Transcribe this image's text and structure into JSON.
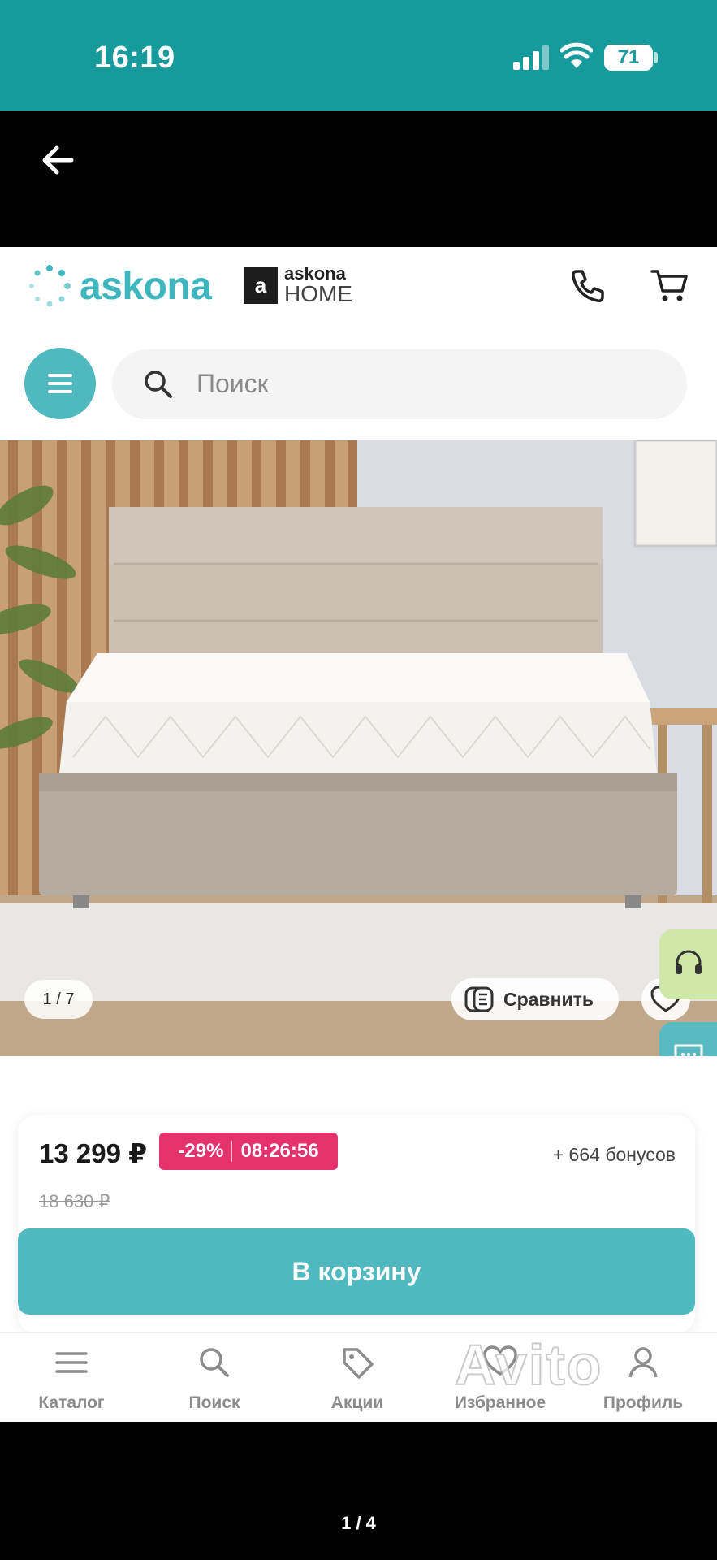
{
  "status_bar": {
    "time": "16:19",
    "battery": "71"
  },
  "header": {
    "logo": "askona",
    "home_logo_box": "a",
    "home_logo_top": "askona",
    "home_logo_bottom": "HOME"
  },
  "search": {
    "placeholder": "Поиск"
  },
  "gallery": {
    "counter": "1 / 7",
    "compare_label": "Сравнить"
  },
  "price_card": {
    "price": "13 299 ₽",
    "discount": "-29%",
    "timer": "08:26:56",
    "bonus": "+ 664 бонусов",
    "old_price": "18 630 ₽",
    "cart_button": "В корзину"
  },
  "bottom_nav": [
    {
      "label": "Каталог",
      "icon": "menu-icon"
    },
    {
      "label": "Поиск",
      "icon": "search-icon"
    },
    {
      "label": "Акции",
      "icon": "tag-icon"
    },
    {
      "label": "Избранное",
      "icon": "heart-icon"
    },
    {
      "label": "Профиль",
      "icon": "user-icon"
    }
  ],
  "watermark": "Avito",
  "viewer_counter": "1 / 4",
  "colors": {
    "brand_teal": "#4fb9bf",
    "status_teal": "#169a9c",
    "discount_pink": "#e4326d"
  }
}
